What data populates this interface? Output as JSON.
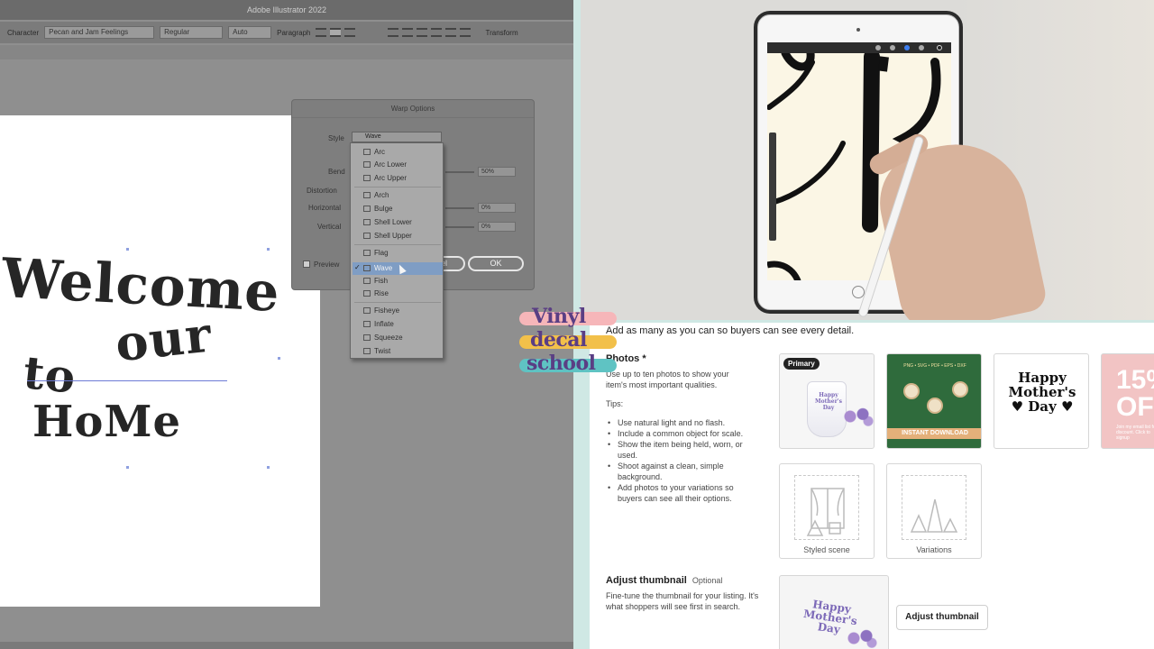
{
  "illustrator": {
    "app_title": "Adobe Illustrator 2022",
    "control_bar": {
      "character_label": "Character",
      "font_value": "Pecan and Jam Feelings",
      "style_value": "Regular",
      "size_value": "Auto",
      "paragraph_label": "Paragraph",
      "transform_label": "Transform"
    },
    "artwork": {
      "line1": "Welcome",
      "line2": "our",
      "line3": "to",
      "line4": "HoMe"
    },
    "warp_dialog": {
      "title": "Warp Options",
      "style_label": "Style",
      "style_value": "Wave",
      "bend_label": "Bend",
      "bend_value": "50%",
      "distortion_label": "Distortion",
      "horizontal_label": "Horizontal",
      "horizontal_value": "0%",
      "vertical_label": "Vertical",
      "vertical_value": "0%",
      "preview_label": "Preview",
      "cancel_label": "Cancel",
      "ok_label": "OK"
    },
    "style_options": [
      "Arc",
      "Arc Lower",
      "Arc Upper",
      "Arch",
      "Bulge",
      "Shell Lower",
      "Shell Upper",
      "Flag",
      "Wave",
      "Fish",
      "Rise",
      "Fisheye",
      "Inflate",
      "Squeeze",
      "Twist"
    ],
    "style_selected": "Wave"
  },
  "logo": {
    "line1": "Vinyl",
    "line2": "decal",
    "line3": "school"
  },
  "etsy": {
    "intro": "Add as many as you can so buyers can see every detail.",
    "photos_heading": "Photos *",
    "photos_sub": "Use up to ten photos to show your item's most important qualities.",
    "tips_label": "Tips:",
    "tips": [
      "Use natural light and no flash.",
      "Include a common object for scale.",
      "Show the item being held, worn, or used.",
      "Shoot against a clean, simple background.",
      "Add photos to your variations so buyers can see all their options."
    ],
    "primary_badge": "Primary",
    "tile1_text": "Happy Mother's Day",
    "tile2_banner": "PNG • SVG • PDF • EPS • DXF",
    "tile2_footer": "INSTANT DOWNLOAD",
    "tile3_line1": "Happy",
    "tile3_line2": "Mother's",
    "tile3_line3": "Day",
    "tile4_big": "15% OF",
    "tile4_small": "Join my email list for a discount. Click to signup",
    "styled_scene_label": "Styled scene",
    "variations_label": "Variations",
    "adjust_heading": "Adjust thumbnail",
    "adjust_optional": "Optional",
    "adjust_sub": "Fine-tune the thumbnail for your listing. It's what shoppers will see first in search.",
    "thumb_text": "Happy Mother's Day",
    "adjust_button": "Adjust thumbnail"
  },
  "colors": {
    "logo_pink": "#f6b6b9",
    "logo_yellow": "#f2c04a",
    "logo_teal": "#5fc3c3",
    "logo_purple": "#5a3e84",
    "frame_teal": "#cfe8e4"
  }
}
